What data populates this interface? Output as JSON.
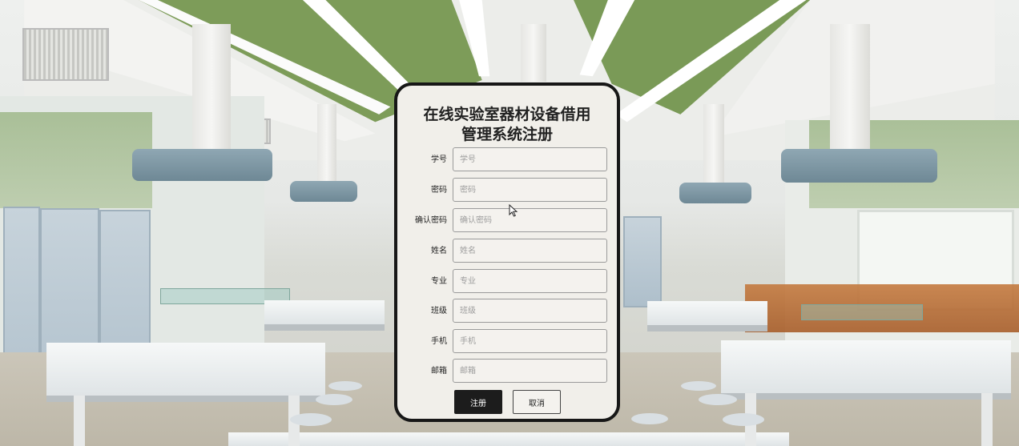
{
  "form": {
    "title_line1": "在线实验室器材设备借用",
    "title_line2": "管理系统注册",
    "fields": [
      {
        "label": "学号",
        "placeholder": "学号",
        "value": ""
      },
      {
        "label": "密码",
        "placeholder": "密码",
        "value": ""
      },
      {
        "label": "确认密码",
        "placeholder": "确认密码",
        "value": ""
      },
      {
        "label": "姓名",
        "placeholder": "姓名",
        "value": ""
      },
      {
        "label": "专业",
        "placeholder": "专业",
        "value": ""
      },
      {
        "label": "班级",
        "placeholder": "班级",
        "value": ""
      },
      {
        "label": "手机",
        "placeholder": "手机",
        "value": ""
      },
      {
        "label": "邮箱",
        "placeholder": "邮箱",
        "value": ""
      }
    ],
    "register_label": "注册",
    "cancel_label": "取消"
  },
  "colors": {
    "modal_bg": "#f1efea",
    "modal_border": "#171717",
    "primary_button": "#1c1c1c",
    "ceiling_green": "#7d9c59"
  },
  "icons": {
    "cursor": "mouse-pointer-icon"
  }
}
